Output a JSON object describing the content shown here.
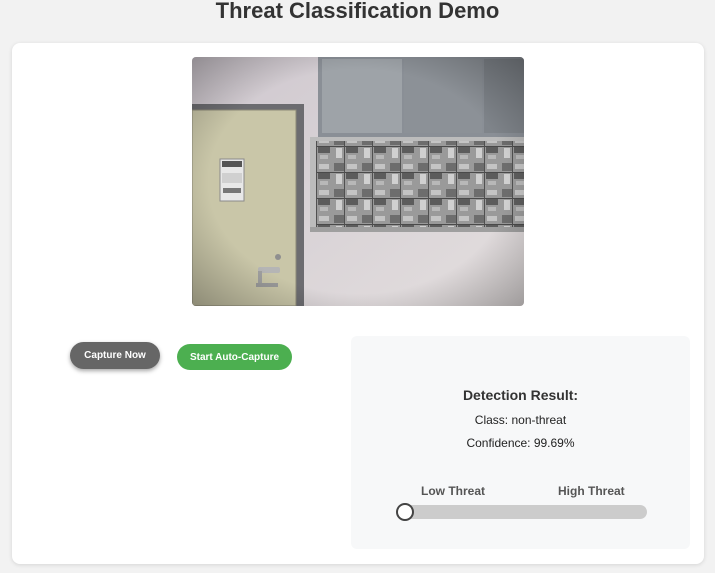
{
  "page": {
    "title": "Threat Classification Demo"
  },
  "camera": {
    "description_icon": "webcam-feed-image"
  },
  "controls": {
    "capture_label": "Capture Now",
    "auto_capture_label": "Start Auto-Capture"
  },
  "result": {
    "heading": "Detection Result:",
    "class_text": "Class: non-threat",
    "confidence_text": "Confidence: 99.69%",
    "scale_low_label": "Low Threat",
    "scale_high_label": "High Threat",
    "threat_level": 0.0
  },
  "colors": {
    "capture_button": "#666666",
    "auto_capture_button": "#4caf50",
    "slider_track": "#cccccc"
  }
}
